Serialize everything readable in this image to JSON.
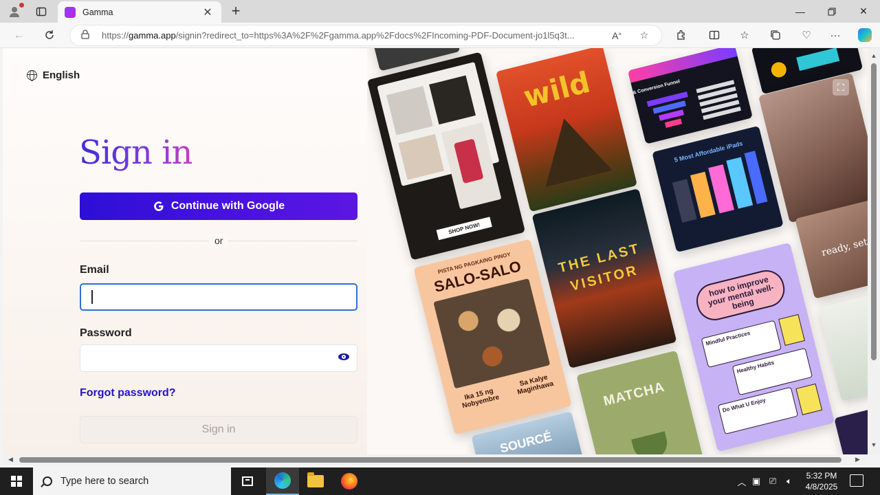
{
  "browser": {
    "tab_title": "Gamma",
    "url_prefix": "https://",
    "url_domain": "gamma.app",
    "url_rest": "/signin?redirect_to=https%3A%2F%2Fgamma.app%2Fdocs%2FIncoming-PDF-Document-jo1l5q3t..."
  },
  "page": {
    "language": "English",
    "title": "Sign in",
    "google_button": "Continue with Google",
    "divider_text": "or",
    "email_label": "Email",
    "email_value": "",
    "password_label": "Password",
    "password_value": "",
    "forgot_link": "Forgot password?",
    "submit_button": "Sign in"
  },
  "collage": {
    "wild": "wild",
    "design_funnel": "Design & Conversion Funnel",
    "ipads": "5 Most Affordable iPads",
    "last_visitor": "THE LAST VISITOR",
    "salo_title": "SALO-SALO",
    "salo_top": "PISTA NG PAGKAING PINOY",
    "salo_bottom_left": "Ika 15 ng Nobyembre",
    "salo_bottom_right": "Sa Kalye Maginhawa",
    "mental": "how to improve your mental well-being",
    "mental_items": [
      "Mindful Practices",
      "Healthy Habits",
      "Do What U Enjoy"
    ],
    "matcha": "MATCHA",
    "source": "SOURCÉ",
    "ready": "ready, set",
    "shop_now": "SHOP NOW!"
  },
  "taskbar": {
    "search_placeholder": "Type here to search",
    "time": "5:32 PM",
    "date": "4/8/2025"
  },
  "colors": {
    "accent": "#3d10db",
    "link": "#2512c9",
    "focus": "#2f6fcf"
  }
}
